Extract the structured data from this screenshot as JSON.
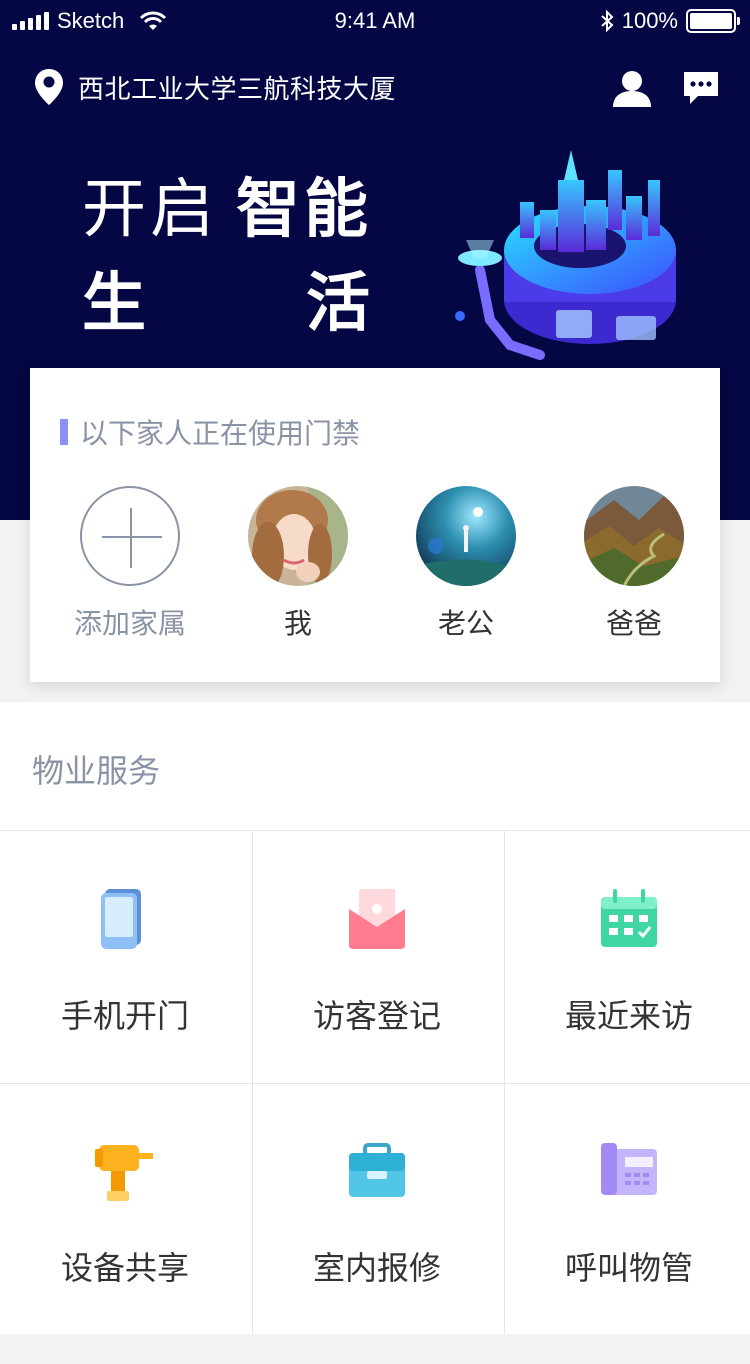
{
  "status_bar": {
    "carrier": "Sketch",
    "time": "9:41 AM",
    "battery": "100%"
  },
  "header": {
    "location": "西北工业大学三航科技大厦",
    "slogan_light": "开启",
    "slogan_bold": "智能",
    "slogan_line2_a": "生",
    "slogan_line2_b": "活"
  },
  "family": {
    "title": "以下家人正在使用门禁",
    "add_label": "添加家属",
    "members": [
      {
        "name": "我"
      },
      {
        "name": "老公"
      },
      {
        "name": "爸爸"
      }
    ]
  },
  "services": {
    "title": "物业服务",
    "items": [
      {
        "label": "手机开门",
        "icon": "phone-icon",
        "color": "#6fa6e8"
      },
      {
        "label": "访客登记",
        "icon": "envelope-icon",
        "color": "#ff7d8e"
      },
      {
        "label": "最近来访",
        "icon": "calendar-icon",
        "color": "#3fd6a4"
      },
      {
        "label": "设备共享",
        "icon": "drill-icon",
        "color": "#ffb21f"
      },
      {
        "label": "室内报修",
        "icon": "toolbox-icon",
        "color": "#52c6e6"
      },
      {
        "label": "呼叫物管",
        "icon": "telephone-icon",
        "color": "#a48af5"
      }
    ]
  }
}
